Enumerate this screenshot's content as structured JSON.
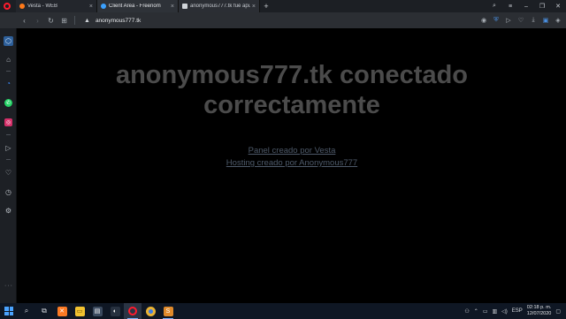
{
  "browser": {
    "tabs": [
      {
        "label": "Vesta - WEB",
        "fav_color": "#ff7a1a"
      },
      {
        "label": "Client Area - Freenom",
        "fav_color": "#3ba1ff"
      },
      {
        "label": "anonymous777.tk fué apu…",
        "fav_color": "#d0d4d9"
      }
    ],
    "new_tab": "+",
    "close_glyph": "×",
    "url": "anonymous777.tk"
  },
  "page": {
    "headline_line1": "anonymous777.tk conectado",
    "headline_line2": "correctamente",
    "link1": "Panel creado por Vesta",
    "link2": "Hosting creado por Anonymous777"
  },
  "taskbar": {
    "lang": "ESP",
    "time": "02:18 p. m.",
    "date": "12/07/2020"
  }
}
